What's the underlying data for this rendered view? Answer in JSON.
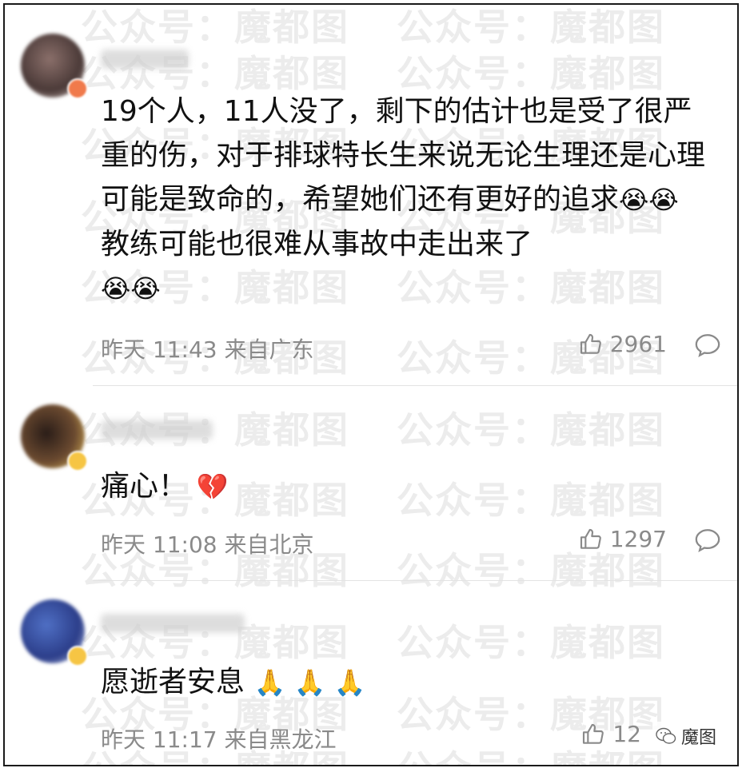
{
  "watermark": {
    "text_full": "公众号：魔都图",
    "text_short": "魔都图"
  },
  "comments": [
    {
      "text": "19个人，11人没了，剩下的估计也是受了很严重的伤，对于排球特长生来说无论生理还是心理可能是致命的，希望她们还有更好的追求",
      "text_after": "教练可能也很难从事故中走出来了",
      "emoji_a": "😭😭",
      "emoji_b": "😭😭",
      "time": "昨天 11:43",
      "source": "来自广东",
      "likes": "2961"
    },
    {
      "text": "痛心！",
      "emoji_a": "💔",
      "time": "昨天 11:08",
      "source": "来自北京",
      "likes": "1297"
    },
    {
      "text": "愿逝者安息",
      "emoji_a": "🙏 🙏 🙏",
      "time": "昨天 11:17",
      "source": "来自黑龙江",
      "likes": "12"
    }
  ],
  "corner_label": "魔图",
  "icons": {
    "like": "thumbs-up-icon",
    "reply": "comment-bubble-icon",
    "wechat": "wechat-icon"
  }
}
